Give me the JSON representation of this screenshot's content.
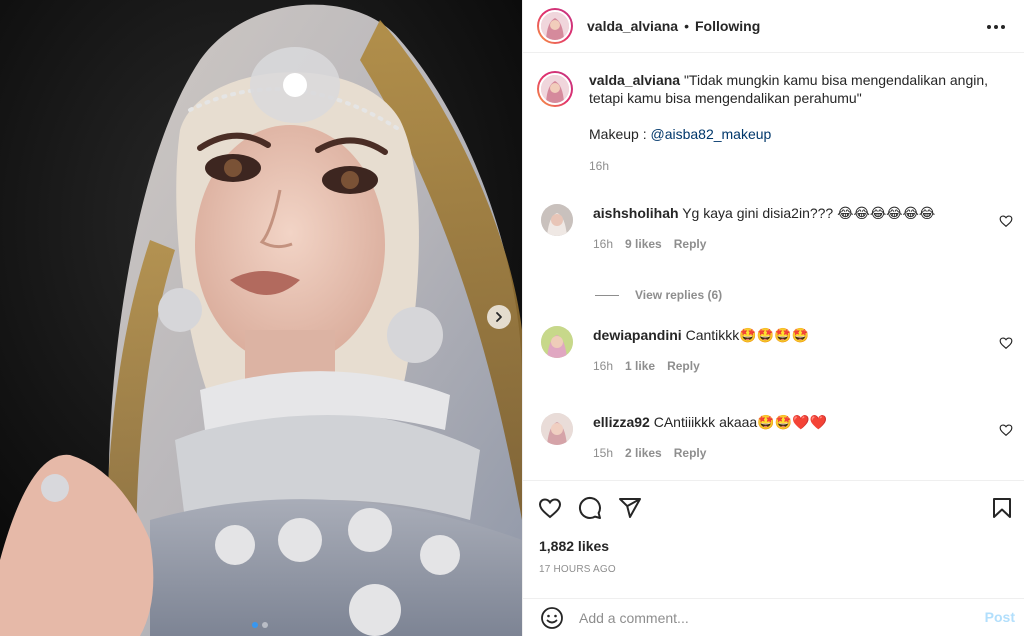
{
  "colors": {
    "text": "#262626",
    "muted": "#8e8e8e",
    "link": "#00376b",
    "post_disabled": "#b2dffc",
    "heart_red": "#ed4956",
    "story_ring": [
      "#f9a03f",
      "#e1306c",
      "#c13584"
    ]
  },
  "header": {
    "username": "valda_alviana",
    "separator": "•",
    "follow_status": "Following",
    "more_icon": "more-horizontal-icon"
  },
  "media": {
    "next_icon": "chevron-right-icon",
    "carousel_total": 2,
    "carousel_active": 1
  },
  "caption": {
    "username": "valda_alviana",
    "text": "\"Tidak mungkin kamu bisa mengendalikan angin, tetapi kamu bisa mengendalikan perahumu\"",
    "makeup_label": "Makeup :",
    "makeup_mention": "@aisba82_makeup",
    "time": "16h"
  },
  "comments": [
    {
      "username": "aishsholihah",
      "text": "Yg kaya gini disia2in??? 😂😂😂😂😂😂",
      "time": "16h",
      "likes": "9 likes",
      "reply": "Reply",
      "view_replies": "View replies (6)"
    },
    {
      "username": "dewiapandini",
      "text": "Cantikkk🤩🤩🤩🤩",
      "time": "16h",
      "likes": "1 like",
      "reply": "Reply"
    },
    {
      "username": "ellizza92",
      "text": "CAntiiikkk akaaa🤩🤩❤️❤️",
      "time": "15h",
      "likes": "2 likes",
      "reply": "Reply"
    }
  ],
  "actions": {
    "icons": [
      "heart-icon",
      "comment-icon",
      "share-icon",
      "bookmark-icon"
    ],
    "likes": "1,882 likes",
    "posted_ago": "17 HOURS AGO"
  },
  "add_comment": {
    "placeholder": "Add a comment...",
    "post_label": "Post"
  }
}
